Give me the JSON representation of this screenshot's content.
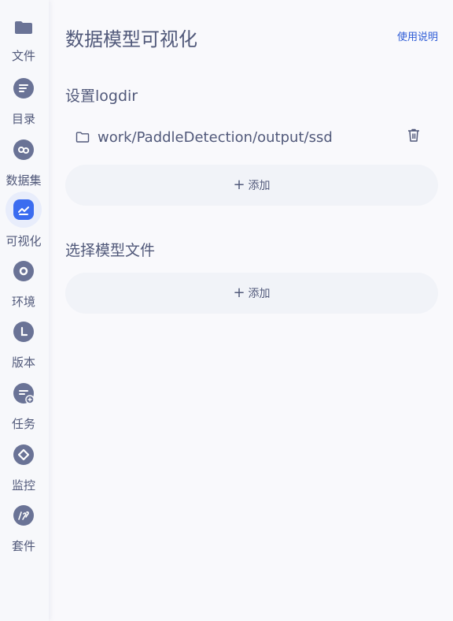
{
  "sidebar": {
    "items": [
      {
        "label": "文件",
        "icon": "folder-icon"
      },
      {
        "label": "目录",
        "icon": "list-icon"
      },
      {
        "label": "数据集",
        "icon": "dataset-icon"
      },
      {
        "label": "可视化",
        "icon": "chart-icon",
        "active": true
      },
      {
        "label": "环境",
        "icon": "circle-icon"
      },
      {
        "label": "版本",
        "icon": "version-icon"
      },
      {
        "label": "任务",
        "icon": "task-icon"
      },
      {
        "label": "监控",
        "icon": "diamond-icon"
      },
      {
        "label": "套件",
        "icon": "suite-icon"
      }
    ]
  },
  "header": {
    "title": "数据模型可视化",
    "help": "使用说明"
  },
  "logdir": {
    "title": "设置logdir",
    "entries": [
      {
        "path": "work/PaddleDetection/output/ssd"
      }
    ],
    "add_label": "添加"
  },
  "model": {
    "title": "选择模型文件",
    "add_label": "添加"
  },
  "colors": {
    "accent": "#2d5bd6",
    "icon": "#6a7396",
    "active_icon": "#3b6cf0"
  }
}
